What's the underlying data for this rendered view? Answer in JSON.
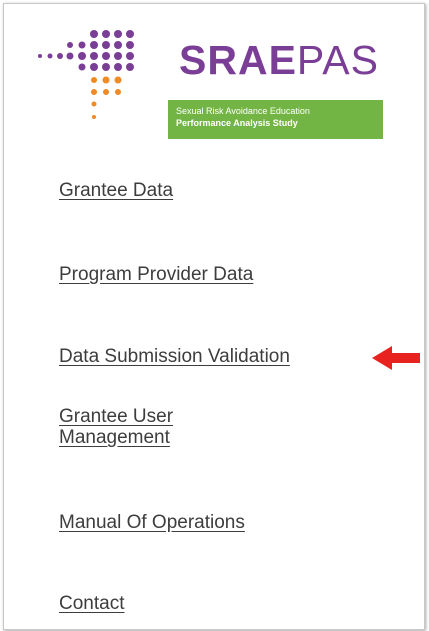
{
  "logo": {
    "title_bold": "SRAE",
    "title_light": "PAS",
    "tagline_line1": "Sexual Risk Avoidance Education",
    "tagline_line2": "Performance Analysis Study",
    "colors": {
      "purple": "#7a3e96",
      "green": "#73b545",
      "orange": "#f08a24"
    }
  },
  "nav": {
    "items": [
      {
        "label": "Grantee Data"
      },
      {
        "label": "Program Provider Data"
      },
      {
        "label": "Data Submission Validation"
      },
      {
        "label": "Grantee User Management"
      },
      {
        "label": "Manual Of Operations"
      },
      {
        "label": "Contact"
      }
    ]
  },
  "annotation": {
    "arrow_color": "#e8231f",
    "arrow_icon": "red-arrow-left-icon"
  }
}
